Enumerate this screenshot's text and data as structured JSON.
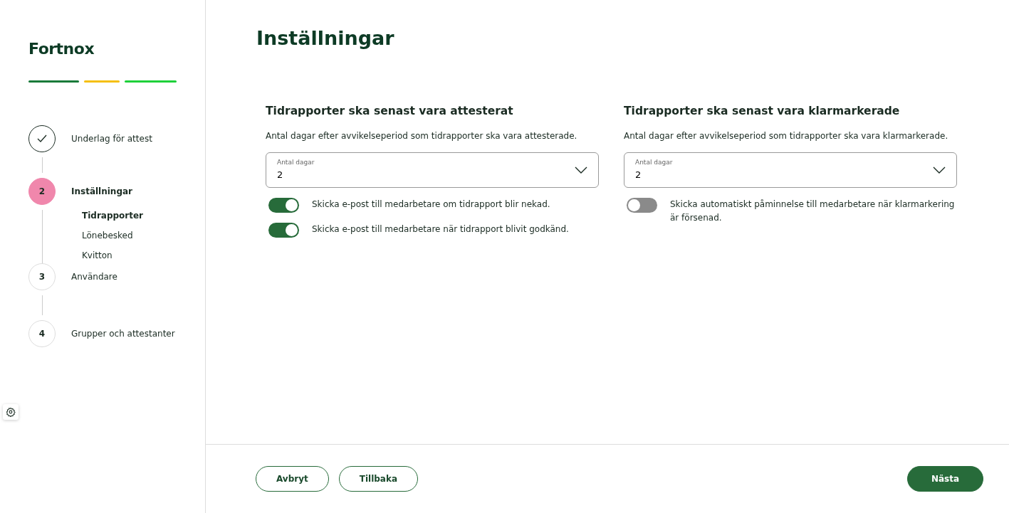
{
  "sidebar": {
    "logo": "Fortnox",
    "steps": [
      {
        "label": "Underlag för attest",
        "completed": true,
        "selected": false
      },
      {
        "marker": "2",
        "label": "Inställningar",
        "completed": false,
        "selected": true,
        "children": [
          {
            "label": "Tidrapporter",
            "selected": true
          },
          {
            "label": "Lönebesked",
            "selected": false
          },
          {
            "label": "Kvitton",
            "selected": false
          }
        ]
      },
      {
        "marker": "3",
        "label": "Användare",
        "completed": false,
        "selected": false
      },
      {
        "marker": "4",
        "label": "Grupper och attestanter",
        "completed": false,
        "selected": false
      }
    ]
  },
  "page_title": "Inställningar",
  "sections": [
    {
      "heading": "Tidrapporter ska senast vara attesterat",
      "description": "Antal dagar efter avvikelseperiod som tidrapporter ska vara attesterade.",
      "select": {
        "label": "Antal dagar",
        "value": "2"
      },
      "toggles": [
        {
          "label": "Skicka e-post till medarbetare om tidrapport blir nekad.",
          "on": true
        },
        {
          "label": "Skicka e-post till medarbetare när tidrapport blivit godkänd.",
          "on": true
        }
      ]
    },
    {
      "heading": "Tidrapporter ska senast vara klarmarkerade",
      "description": "Antal dagar efter avvikelseperiod som tidrapporter ska vara klarmarkerade.",
      "select": {
        "label": "Antal dagar",
        "value": "2"
      },
      "toggles": [
        {
          "label": "Skicka automatiskt påminnelse till medarbetare när klarmarkering är försenad.",
          "on": false
        }
      ]
    }
  ],
  "footer": {
    "buttons": [
      {
        "label": "Avbryt",
        "kind": "outline"
      },
      {
        "label": "Tillbaka",
        "kind": "outline"
      },
      {
        "label": "Nästa",
        "kind": "primary"
      }
    ]
  }
}
